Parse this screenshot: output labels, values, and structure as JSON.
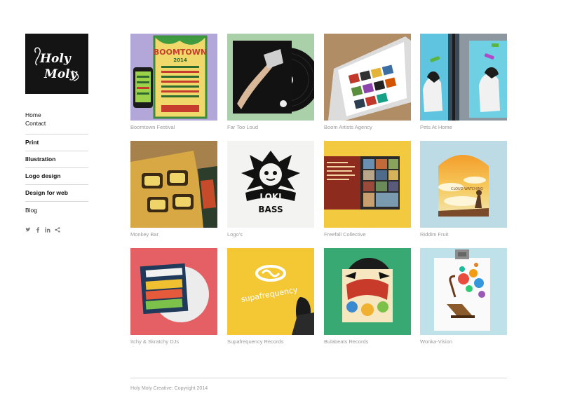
{
  "brand": {
    "logo_text": "Holy Moly"
  },
  "nav": {
    "home": "Home",
    "contact": "Contact",
    "categories": [
      "Print",
      "Illustration",
      "Logo design",
      "Design for web"
    ],
    "blog": "Blog"
  },
  "social_icons": [
    "twitter-icon",
    "facebook-icon",
    "linkedin-icon",
    "share-icon"
  ],
  "portfolio": [
    {
      "caption": "Boomtown Festival",
      "poster_text": "BOOMTOWN",
      "year_text": "2014"
    },
    {
      "caption": "Far Too Loud"
    },
    {
      "caption": "Boom Artists Agency"
    },
    {
      "caption": "Pets At Home"
    },
    {
      "caption": "Monkey Bar"
    },
    {
      "caption": "Logo's",
      "logo_word1": "LOKI",
      "logo_word2": "BASS"
    },
    {
      "caption": "Freefall Collective"
    },
    {
      "caption": "Riddim Fruit",
      "art_text": "CLOUD WATCHING"
    },
    {
      "caption": "Itchy & Skratchy DJs"
    },
    {
      "caption": "Supafrequency Records",
      "art_text": "supafrequency"
    },
    {
      "caption": "Bulabeats Records"
    },
    {
      "caption": "Wonka-Vision"
    }
  ],
  "footer": {
    "copyright": "Holy Moly Creative: Copyright 2014"
  },
  "colors": {
    "logo_bg": "#141414",
    "caption": "#9a9a9a",
    "rule": "#d8d8d8"
  }
}
